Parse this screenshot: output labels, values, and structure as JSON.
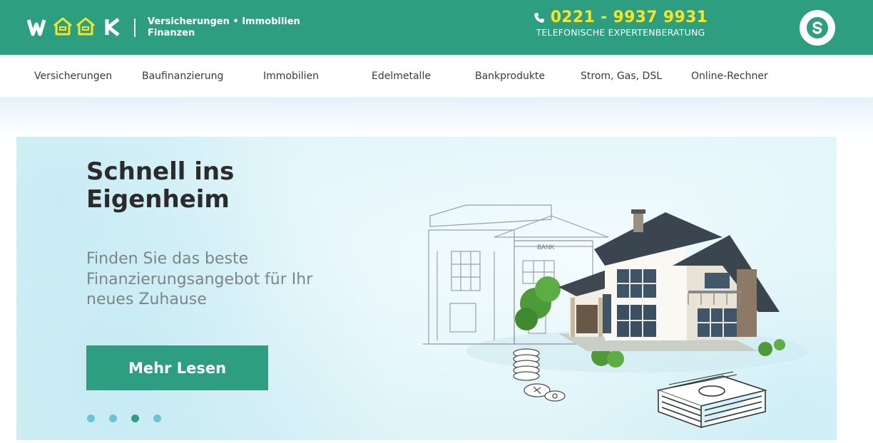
{
  "header": {
    "logo_text": "WOOK",
    "tagline_line1": "Versicherungen • Immobilien",
    "tagline_line2": "Finanzen",
    "phone_number": "0221 - 9937 9931",
    "phone_caption": "TELEFONISCHE EXPERTENBERATUNG",
    "icons": {
      "phone": "phone-icon",
      "skype": "skype-icon"
    },
    "colors": {
      "brand": "#2e9e80",
      "phone_accent": "#f5e52a"
    }
  },
  "nav": {
    "items": [
      {
        "label": "Versicherungen"
      },
      {
        "label": "Baufinanzierung"
      },
      {
        "label": "Immobilien"
      },
      {
        "label": "Edelmetalle"
      },
      {
        "label": "Bankprodukte"
      },
      {
        "label": "Strom, Gas, DSL"
      },
      {
        "label": "Online-Rechner"
      }
    ]
  },
  "hero": {
    "title": "Schnell ins Eigenheim",
    "subtitle": "Finden Sie das beste Finanzierungsangebot für Ihr neues Zuhause",
    "cta_label": "Mehr Lesen",
    "bank_sign": "BANK",
    "slides_total": 4,
    "active_slide": 3,
    "colors": {
      "cta": "#2e9e80",
      "dot": "#6cc3d2",
      "dot_active": "#2e9e80"
    }
  }
}
